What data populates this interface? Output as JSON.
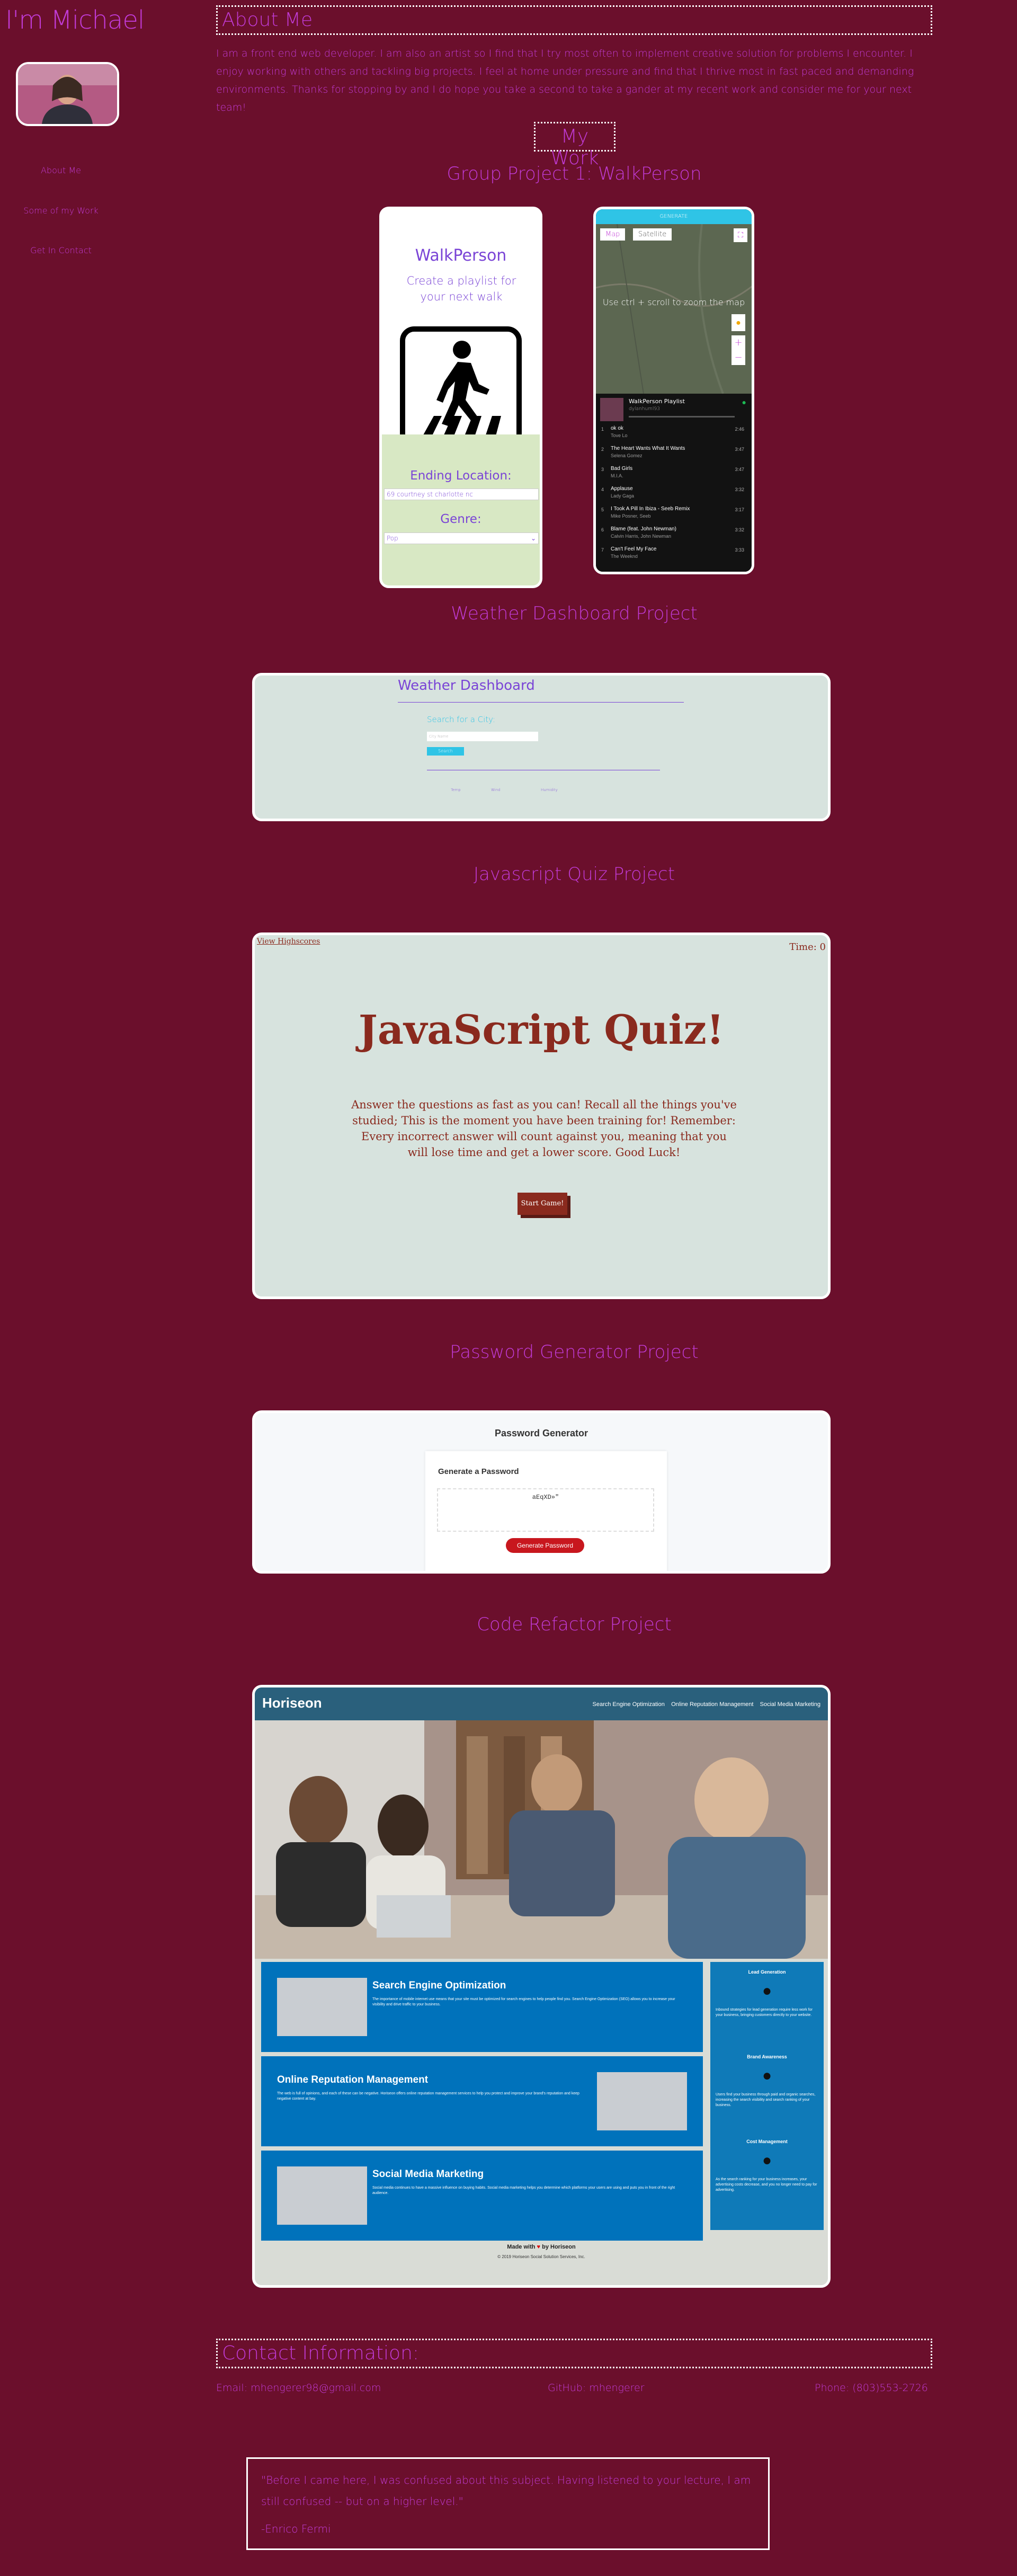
{
  "brand": "I'm Michael",
  "nav": [
    "About Me",
    "Some of my Work",
    "Get In Contact"
  ],
  "about": {
    "heading": "About Me",
    "text": "I am a front end web developer. I am also an artist so I find that I try most often to implement creative solution for problems I encounter. I enjoy working with others and tackling big projects. I feel at home under pressure and find that I thrive most in fast paced and demanding environments. Thanks for stopping by and I do hope you take a second to take a gander at my recent work and consider me for your next team!"
  },
  "work": {
    "heading": "My Work",
    "projects": [
      {
        "title": "Group Project 1: WalkPerson",
        "walk": {
          "app_title": "WalkPerson",
          "tagline": "Create a playlist for your next walk",
          "ending_label": "Ending Location:",
          "ending_value": "69 courtney st charlotte nc",
          "genre_label": "Genre:",
          "genre_value": "Pop",
          "map_bar": "GENERATE",
          "map_tabs": [
            "Map",
            "Satellite"
          ],
          "map_hint": "Use ctrl + scroll to zoom the map",
          "playlist_name": "WalkPerson Playlist",
          "playlist_user": "dylanhuml93",
          "tracks": [
            {
              "n": "1",
              "t": "ok ok",
              "a": "Tove Lo",
              "d": "2:46"
            },
            {
              "n": "2",
              "t": "The Heart Wants What It Wants",
              "a": "Selena Gomez",
              "d": "3:47"
            },
            {
              "n": "3",
              "t": "Bad Girls",
              "a": "M.I.A.",
              "d": "3:47"
            },
            {
              "n": "4",
              "t": "Applause",
              "a": "Lady Gaga",
              "d": "3:32"
            },
            {
              "n": "5",
              "t": "I Took A Pill In Ibiza - Seeb Remix",
              "a": "Mike Posner, Seeb",
              "d": "3:17"
            },
            {
              "n": "6",
              "t": "Blame (feat. John Newman)",
              "a": "Calvin Harris, John Newman",
              "d": "3:32"
            },
            {
              "n": "7",
              "t": "Can't Feel My Face",
              "a": "The Weeknd",
              "d": "3:33"
            }
          ]
        }
      },
      {
        "title": "Weather Dashboard Project",
        "weather": {
          "app_title": "Weather Dashboard",
          "search_label": "Search for a City:",
          "search_placeholder": "City Name",
          "search_button": "Search",
          "stats": [
            "Temp",
            "Wind",
            "Humidity"
          ]
        }
      },
      {
        "title": "Javascript Quiz Project",
        "quiz": {
          "highscores": "View Highscores",
          "timer": "Time: 0",
          "title": "JavaScript Quiz!",
          "intro": "Answer the questions as fast as you can! Recall all the things you've studied; This is the moment you have been training for! Remember: Every incorrect answer will count against you, meaning that you will lose time and get a lower score. Good Luck!",
          "start": "Start Game!"
        }
      },
      {
        "title": "Password Generator Project",
        "password": {
          "app_title": "Password Generator",
          "card_title": "Generate a Password",
          "output": "aEqXD»\"",
          "button": "Generate Password"
        }
      },
      {
        "title": "Code Refactor Project",
        "horiseon": {
          "logo": "Horiseon",
          "nav": [
            "Search Engine Optimization",
            "Online Reputation Management",
            "Social Media Marketing"
          ],
          "cards": [
            {
              "title": "Search Engine Optimization",
              "text": "The importance of mobile internet use means that your site must be optimized for search engines to help people find you. Search Engine Optimization (SEO) allows you to increase your visibility and drive traffic to your business."
            },
            {
              "title": "Online Reputation Management",
              "text": "The web is full of opinions, and each of these can be negative. Horiseon offers online reputation management services to help you protect and improve your brand's reputation and keep negative content at bay."
            },
            {
              "title": "Social Media Marketing",
              "text": "Social media continues to have a massive influence on buying habits. Social media marketing helps you determine which platforms your users are using and puts you in front of the right audience."
            }
          ],
          "benefits": [
            {
              "title": "Lead Generation",
              "text": "Inbound strategies for lead generation require less work for your business, bringing customers directly to your website."
            },
            {
              "title": "Brand Awareness",
              "text": "Users find your business through paid and organic searches, increasing the search visibility and search ranking of your business."
            },
            {
              "title": "Cost Management",
              "text": "As the search ranking for your business increases, your advertising costs decrease, and you no longer need to pay for advertising."
            }
          ],
          "footer_made": "Made with",
          "footer_by": "by Horiseon",
          "footer_copy": "© 2019 Horiseon Social Solution Services, Inc."
        }
      }
    ]
  },
  "contact": {
    "heading": "Contact Information:",
    "email": "Email: mhengerer98@gmail.com",
    "github": "GitHub: mhengerer",
    "phone": "Phone: (803)553-2726"
  },
  "quote": {
    "text": "\"Before I came here, I was confused about this subject. Having listened to your lecture, I am still confused -- but on a higher level.\"",
    "author": "-Enrico Fermi"
  },
  "colors": {
    "background": "#6b0f2c",
    "text": "#c13bd6",
    "quiz_title": "#8a2a1e",
    "horiseon_blue": "#0072bb",
    "horiseon_dark": "#2a607c",
    "walk_purple": "#7a44d6",
    "weather_cyan": "#2fc4e6"
  }
}
